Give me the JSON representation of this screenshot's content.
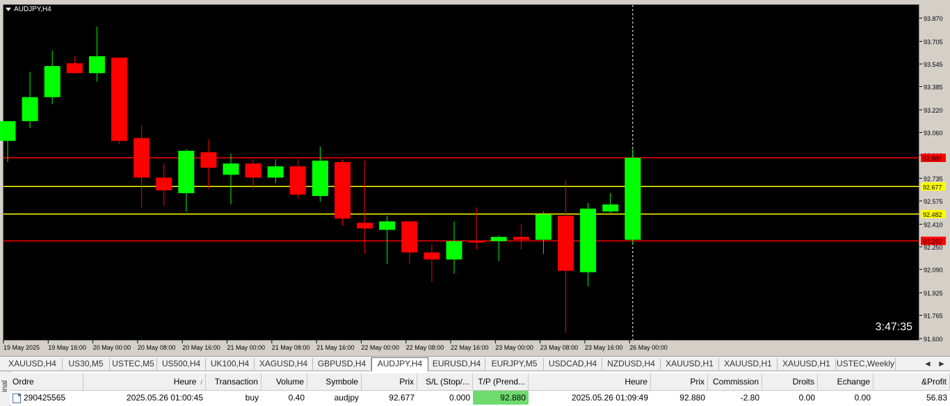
{
  "chart": {
    "symbol_label": "AUDJPY,H4",
    "countdown": "3:47:35",
    "colors": {
      "bull": "#00ff00",
      "bear": "#ff0000",
      "background": "#000000",
      "grid_text": "#ffffff"
    },
    "price_axis_labels": [
      "93.870",
      "93.705",
      "93.545",
      "93.385",
      "93.220",
      "93.060",
      "92.900",
      "92.735",
      "92.575",
      "92.410",
      "92.250",
      "92.090",
      "91.925",
      "91.765",
      "91.600"
    ],
    "time_axis_labels": [
      "19 May 2025",
      "19 May 16:00",
      "20 May 00:00",
      "20 May 08:00",
      "20 May 16:00",
      "21 May 00:00",
      "21 May 08:00",
      "21 May 16:00",
      "22 May 00:00",
      "22 May 08:00",
      "22 May 16:00",
      "23 May 00:00",
      "23 May 08:00",
      "23 May 16:00",
      "26 May 00:00"
    ],
    "lines": [
      {
        "price": 92.88,
        "label": "92.880",
        "color": "#ff0000",
        "label_bg": "#ff0000",
        "label_fg": "#000000"
      },
      {
        "price": 92.677,
        "label": "92.677",
        "color": "#ffff00",
        "label_bg": "#ffff00",
        "label_fg": "#000000"
      },
      {
        "price": 92.482,
        "label": "92.482",
        "color": "#ffff00",
        "label_bg": "#ffff00",
        "label_fg": "#000000"
      },
      {
        "price": 92.292,
        "label": "92.292",
        "color": "#ff0000",
        "label_bg": "#ff0000",
        "label_fg": "#000000"
      }
    ]
  },
  "chart_data": {
    "type": "candlestick",
    "ylim": [
      91.6,
      93.87
    ],
    "candles": [
      {
        "o": 93.0,
        "h": 93.1,
        "l": 92.85,
        "c": 93.14
      },
      {
        "o": 93.14,
        "h": 93.49,
        "l": 93.09,
        "c": 93.31
      },
      {
        "o": 93.31,
        "h": 93.64,
        "l": 93.26,
        "c": 93.53
      },
      {
        "o": 93.55,
        "h": 93.6,
        "l": 93.48,
        "c": 93.48
      },
      {
        "o": 93.48,
        "h": 93.81,
        "l": 93.42,
        "c": 93.6
      },
      {
        "o": 93.59,
        "h": 93.59,
        "l": 92.98,
        "c": 93.0
      },
      {
        "o": 93.02,
        "h": 93.11,
        "l": 92.53,
        "c": 92.74
      },
      {
        "o": 92.74,
        "h": 92.84,
        "l": 92.54,
        "c": 92.65
      },
      {
        "o": 92.63,
        "h": 92.94,
        "l": 92.5,
        "c": 92.93
      },
      {
        "o": 92.92,
        "h": 93.01,
        "l": 92.66,
        "c": 92.81
      },
      {
        "o": 92.76,
        "h": 92.91,
        "l": 92.55,
        "c": 92.84
      },
      {
        "o": 92.84,
        "h": 92.87,
        "l": 92.66,
        "c": 92.74
      },
      {
        "o": 92.74,
        "h": 92.87,
        "l": 92.7,
        "c": 92.82
      },
      {
        "o": 92.82,
        "h": 92.87,
        "l": 92.59,
        "c": 92.62
      },
      {
        "o": 92.61,
        "h": 92.96,
        "l": 92.57,
        "c": 92.86
      },
      {
        "o": 92.85,
        "h": 92.87,
        "l": 92.4,
        "c": 92.45
      },
      {
        "o": 92.42,
        "h": 92.86,
        "l": 92.2,
        "c": 92.38
      },
      {
        "o": 92.37,
        "h": 92.47,
        "l": 92.13,
        "c": 92.43
      },
      {
        "o": 92.43,
        "h": 92.43,
        "l": 92.13,
        "c": 92.21
      },
      {
        "o": 92.21,
        "h": 92.27,
        "l": 92.0,
        "c": 92.16
      },
      {
        "o": 92.16,
        "h": 92.43,
        "l": 92.06,
        "c": 92.29
      },
      {
        "o": 92.29,
        "h": 92.53,
        "l": 92.23,
        "c": 92.28
      },
      {
        "o": 92.29,
        "h": 92.33,
        "l": 92.15,
        "c": 92.32
      },
      {
        "o": 92.32,
        "h": 92.41,
        "l": 92.23,
        "c": 92.3
      },
      {
        "o": 92.3,
        "h": 92.5,
        "l": 92.2,
        "c": 92.48
      },
      {
        "o": 92.47,
        "h": 92.72,
        "l": 91.64,
        "c": 92.08
      },
      {
        "o": 92.07,
        "h": 92.56,
        "l": 91.97,
        "c": 92.52
      },
      {
        "o": 92.5,
        "h": 92.63,
        "l": 92.49,
        "c": 92.55
      },
      {
        "o": 92.3,
        "h": 92.95,
        "l": 92.27,
        "c": 92.88
      }
    ]
  },
  "tabs": [
    {
      "label": "XAUUSD,H4",
      "active": false
    },
    {
      "label": "US30,M5",
      "active": false
    },
    {
      "label": "USTEC,M5",
      "active": false
    },
    {
      "label": "US500,H4",
      "active": false
    },
    {
      "label": "UK100,H4",
      "active": false
    },
    {
      "label": "XAGUSD,H4",
      "active": false
    },
    {
      "label": "GBPUSD,H4",
      "active": false
    },
    {
      "label": "AUDJPY,H4",
      "active": true
    },
    {
      "label": "EURUSD,H4",
      "active": false
    },
    {
      "label": "EURJPY,M5",
      "active": false
    },
    {
      "label": "USDCAD,H4",
      "active": false
    },
    {
      "label": "NZDUSD,H4",
      "active": false
    },
    {
      "label": "XAUUSD,H1",
      "active": false
    },
    {
      "label": "XAUUSD,H1",
      "active": false
    },
    {
      "label": "XAUUSD,H1",
      "active": false
    },
    {
      "label": "USTEC,Weekly",
      "active": false
    }
  ],
  "tab_scroll": {
    "left": "◄",
    "right": "►"
  },
  "terminal": {
    "side_label": "inal",
    "columns": [
      "Ordre",
      "Heure",
      "Transaction",
      "Volume",
      "Symbole",
      "Prix",
      "S/L (Stop/...",
      "T/P (Prend...",
      "Heure",
      "Prix",
      "Commission",
      "Droits",
      "Echange",
      "&Profit"
    ],
    "sort_indicator": "/",
    "rows": [
      [
        "290425565",
        "2025.05.26 01:00:45",
        "buy",
        "0.40",
        "audjpy",
        "92.677",
        "0.000",
        "92.880",
        "2025.05.26 01:09:49",
        "92.880",
        "-2.80",
        "0.00",
        "0.00",
        "56.83"
      ]
    ]
  }
}
